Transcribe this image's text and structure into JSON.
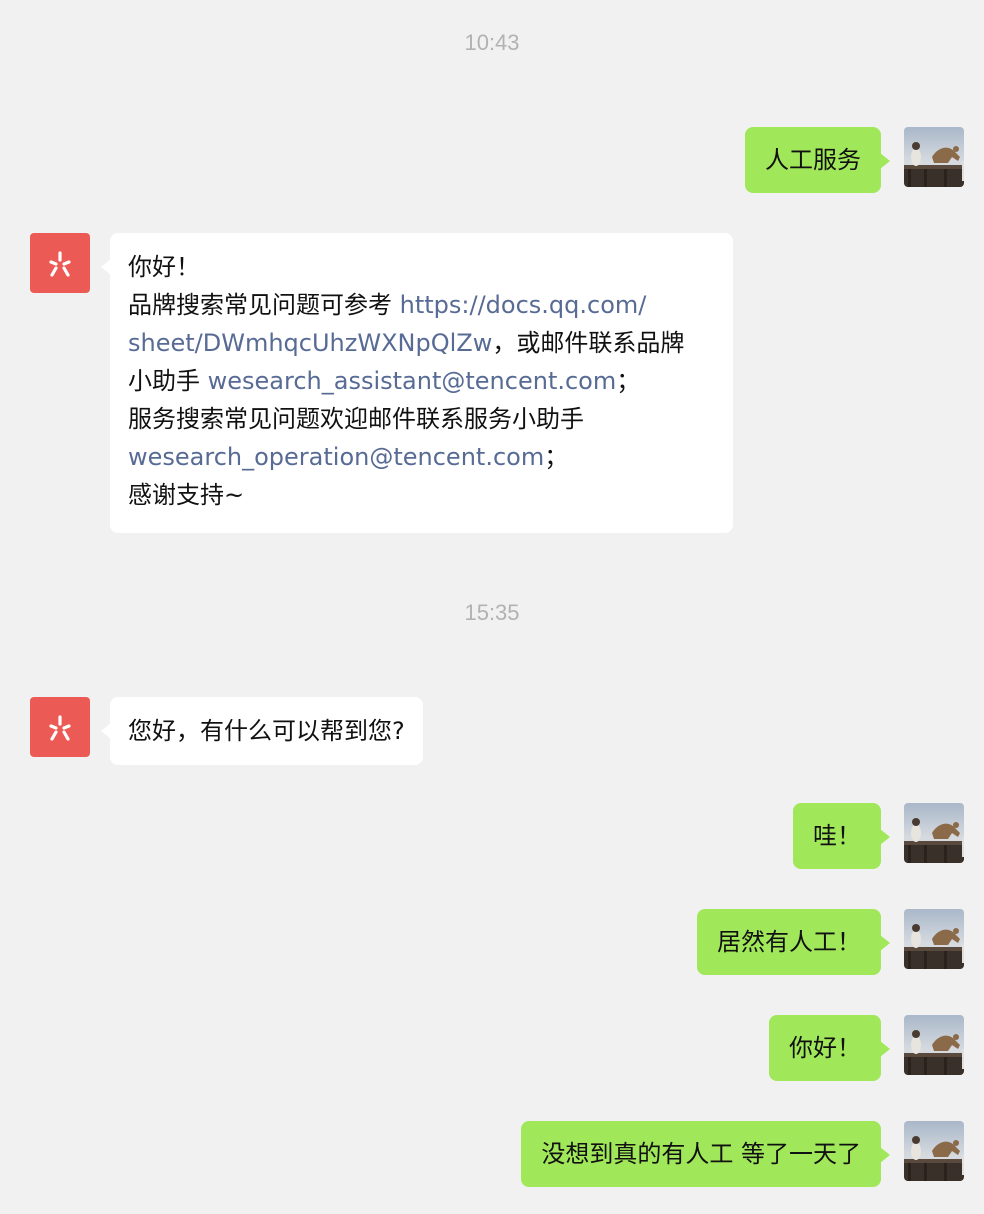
{
  "chat": {
    "timestamps": [
      "10:43",
      "15:35"
    ],
    "colors": {
      "background": "#f1f1f1",
      "my_bubble": "#a0e75a",
      "their_bubble": "#ffffff",
      "link": "#576b95",
      "bot_avatar": "#ec5a55"
    },
    "icons": {
      "bot_avatar": "wesearch-logo-icon",
      "user_avatar": "user-photo-avatar"
    },
    "messages": [
      {
        "from": "me",
        "text": "人工服务"
      },
      {
        "from": "them",
        "greeting": "你好！",
        "line2_text": "品牌搜索常见问题可参考 ",
        "line2_link": "https://docs.qq.com/",
        "line3_link": "sheet/DWmhqcUhzWXNpQlZw",
        "line3_text": "，或邮件联系品牌",
        "line4_text": "小助手 ",
        "line4_link": "wesearch_assistant@tencent.com",
        "line4_suffix": "；",
        "line5_text": "服务搜索常见问题欢迎邮件联系服务小助手",
        "line6_link": "wesearch_operation@tencent.com",
        "line6_suffix": "；",
        "line7_text": "感谢支持~"
      },
      {
        "from": "them",
        "text": "您好，有什么可以帮到您?"
      },
      {
        "from": "me",
        "text": "哇！"
      },
      {
        "from": "me",
        "text": "居然有人工！"
      },
      {
        "from": "me",
        "text": "你好！"
      },
      {
        "from": "me",
        "text": "没想到真的有人工 等了一天了"
      }
    ]
  }
}
